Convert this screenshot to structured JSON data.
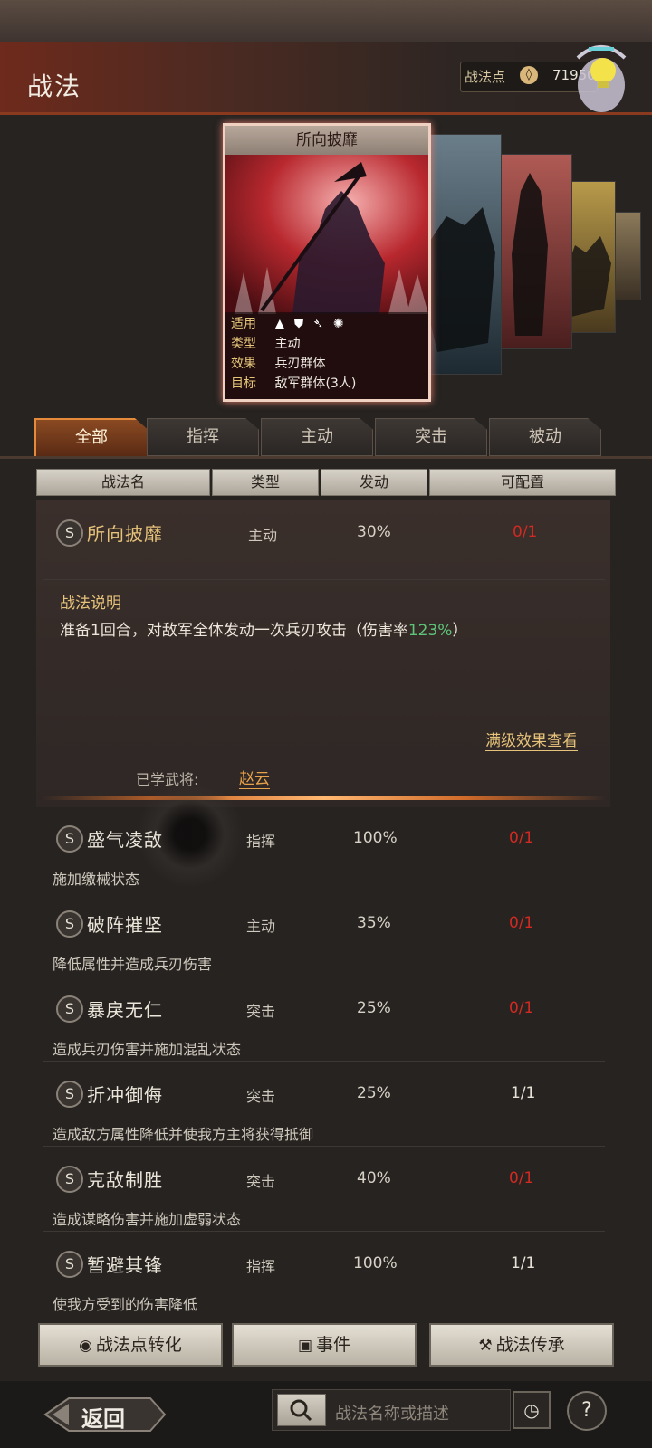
{
  "header": {
    "title": "战法",
    "points_label": "战法点",
    "points_value": "71950"
  },
  "featured_card": {
    "title": "所向披靡",
    "info": [
      {
        "key": "适用",
        "value": ""
      },
      {
        "key": "类型",
        "value": "主动"
      },
      {
        "key": "效果",
        "value": "兵刃群体"
      },
      {
        "key": "目标",
        "value": "敌军群体(3人)"
      }
    ],
    "suitable_icons": [
      "cavalry-icon",
      "shield-icon",
      "bow-icon",
      "siege-icon"
    ]
  },
  "tabs": [
    {
      "label": "全部",
      "active": true
    },
    {
      "label": "指挥",
      "active": false
    },
    {
      "label": "主动",
      "active": false
    },
    {
      "label": "突击",
      "active": false
    },
    {
      "label": "被动",
      "active": false
    }
  ],
  "columns": [
    "战法名",
    "类型",
    "发动",
    "可配置"
  ],
  "badge": "S",
  "expanded": {
    "name": "所向披靡",
    "type": "主动",
    "rate": "30%",
    "configurable": "0/1",
    "detail_label": "战法说明",
    "detail_pre": "准备1回合，对敌军全体发动一次兵刃攻击（伤害率",
    "detail_value": "123%",
    "detail_post": "）",
    "full_effect_link": "满级效果查看",
    "learned_label": "已学武将:",
    "learned_general": "赵云"
  },
  "skills": [
    {
      "name": "盛气凌敌",
      "type": "指挥",
      "rate": "100%",
      "configurable": "0/1",
      "desc": "施加缴械状态"
    },
    {
      "name": "破阵摧坚",
      "type": "主动",
      "rate": "35%",
      "configurable": "0/1",
      "desc": "降低属性并造成兵刃伤害"
    },
    {
      "name": "暴戾无仁",
      "type": "突击",
      "rate": "25%",
      "configurable": "0/1",
      "desc": "造成兵刃伤害并施加混乱状态"
    },
    {
      "name": "折冲御侮",
      "type": "突击",
      "rate": "25%",
      "configurable": "1/1",
      "desc": "造成敌方属性降低并使我方主将获得抵御"
    },
    {
      "name": "克敌制胜",
      "type": "突击",
      "rate": "40%",
      "configurable": "0/1",
      "desc": "造成谋略伤害并施加虚弱状态"
    },
    {
      "name": "暂避其锋",
      "type": "指挥",
      "rate": "100%",
      "configurable": "1/1",
      "desc": "使我方受到的伤害降低"
    }
  ],
  "buttons": {
    "convert": "战法点转化",
    "events": "事件",
    "inherit": "战法传承"
  },
  "footer": {
    "back": "返回",
    "search_placeholder": "战法名称或描述",
    "help": "?"
  },
  "colors": {
    "accent_gold": "#e6c27a",
    "configurable_red": "#d02a22",
    "damage_green": "#5ec47a",
    "tab_active_border": "#e58a3a"
  }
}
